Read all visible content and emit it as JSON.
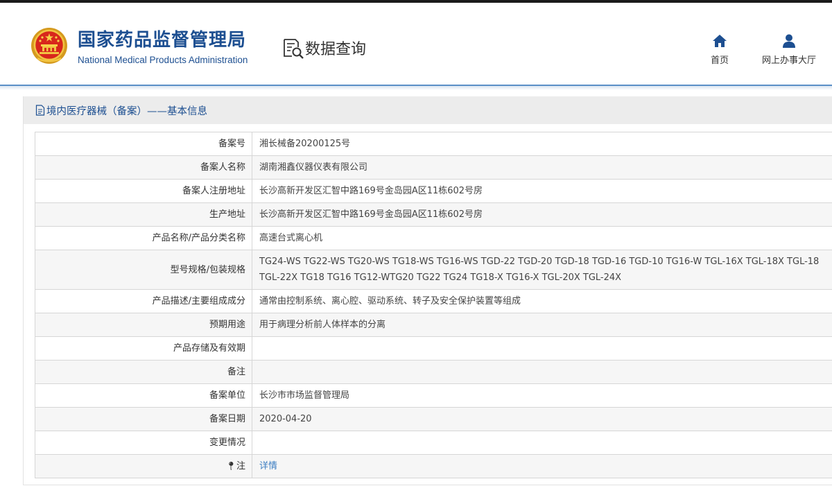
{
  "header": {
    "org_name_cn": "国家药品监督管理局",
    "org_name_en": "National Medical Products Administration",
    "search_title": "数据查询",
    "emblem_icon": "national-emblem-icon",
    "search_icon": "data-search-icon",
    "nav": {
      "home": {
        "label": "首页",
        "icon": "home-icon"
      },
      "online": {
        "label": "网上办事大厅",
        "icon": "user-icon"
      }
    }
  },
  "panel": {
    "title": "境内医疗器械（备案）——基本信息",
    "icon": "document-icon"
  },
  "record": [
    {
      "label": "备案号",
      "value": "湘长械备20200125号"
    },
    {
      "label": "备案人名称",
      "value": "湖南湘鑫仪器仪表有限公司"
    },
    {
      "label": "备案人注册地址",
      "value": "长沙高新开发区汇智中路169号金岛园A区11栋602号房"
    },
    {
      "label": "生产地址",
      "value": "长沙高新开发区汇智中路169号金岛园A区11栋602号房"
    },
    {
      "label": "产品名称/产品分类名称",
      "value": "高速台式离心机"
    },
    {
      "label": "型号规格/包装规格",
      "value": "TG24-WS TG22-WS TG20-WS TG18-WS TG16-WS TGD-22 TGD-20 TGD-18 TGD-16 TGD-10 TG16-W TGL-16X TGL-18X TGL-18 TGL-22X TG18 TG16 TG12-WTG20 TG22 TG24 TG18-X TG16-X TGL-20X TGL-24X"
    },
    {
      "label": "产品描述/主要组成成分",
      "value": "通常由控制系统、离心腔、驱动系统、转子及安全保护装置等组成"
    },
    {
      "label": "预期用途",
      "value": "用于病理分析前人体样本的分离"
    },
    {
      "label": "产品存储及有效期",
      "value": ""
    },
    {
      "label": "备注",
      "value": ""
    },
    {
      "label": "备案单位",
      "value": "长沙市市场监督管理局"
    },
    {
      "label": "备案日期",
      "value": "2020-04-20"
    },
    {
      "label": "变更情况",
      "value": ""
    },
    {
      "label": "注",
      "value": "详情",
      "label_icon": "pin-icon"
    }
  ],
  "colors": {
    "brand_blue": "#1d4f91",
    "link_blue": "#3c7ec2",
    "header_rule": "#5b8fc7"
  }
}
